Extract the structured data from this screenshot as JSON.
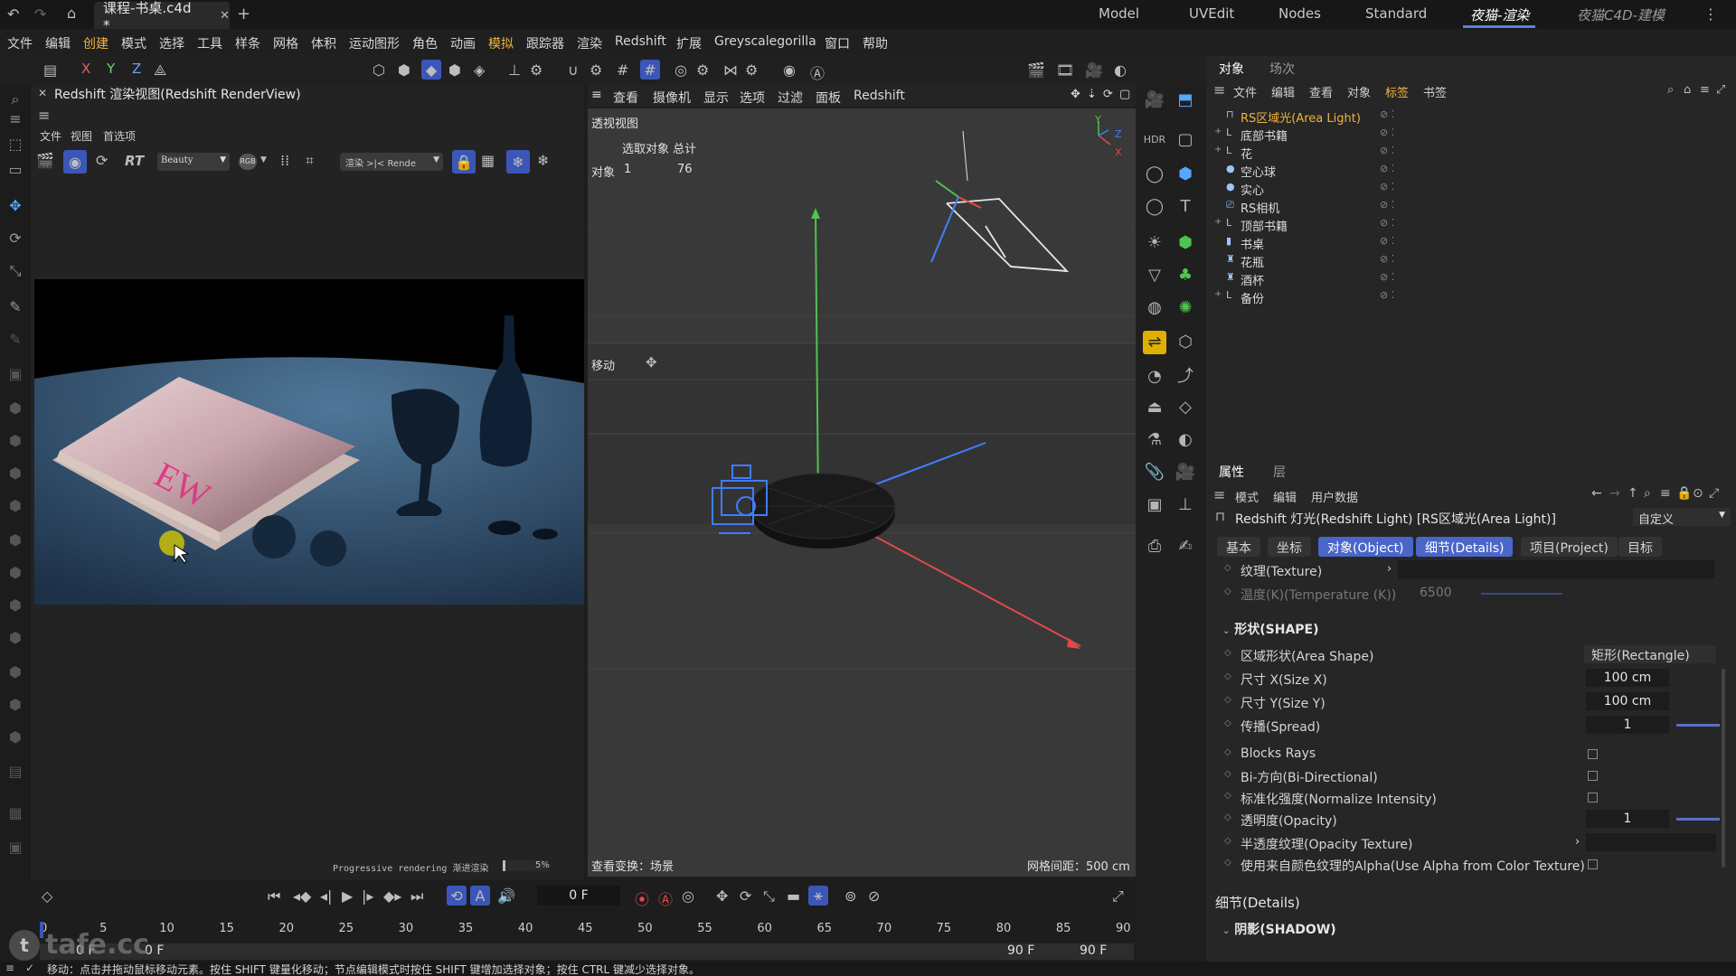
{
  "title_bar": {
    "doc_tab": "课程-书桌.c4d *",
    "layouts": [
      "Model",
      "UVEdit",
      "Nodes",
      "Standard",
      "夜猫-渲染",
      "夜猫C4D-建模"
    ],
    "active_layout": "夜猫-渲染"
  },
  "menu": [
    "文件",
    "编辑",
    "创建",
    "模式",
    "选择",
    "工具",
    "样条",
    "网格",
    "体积",
    "运动图形",
    "角色",
    "动画",
    "模拟",
    "跟踪器",
    "渲染",
    "Redshift",
    "扩展",
    "Greyscalegorilla",
    "窗口",
    "帮助"
  ],
  "axis_buttons": [
    "X",
    "Y",
    "Z"
  ],
  "render_view": {
    "title": "Redshift 渲染视图(Redshift RenderView)",
    "menu": [
      "文件",
      "视图",
      "首选项"
    ],
    "aov_select": "Beauty",
    "rgb_label": "RGB",
    "rt_label": "RT",
    "render_select": "渲染 >|< Rende",
    "status_text": "Progressive rendering 渐进渲染",
    "progress_percent": "5%",
    "progress_value": 0.05
  },
  "viewport": {
    "menu": [
      "查看",
      "摄像机",
      "显示",
      "选项",
      "过滤",
      "面板",
      "Redshift"
    ],
    "name": "透视视图",
    "stats_header": "选取对象 总计",
    "stats_label": "对象",
    "stats_selected": "1",
    "stats_total": "76",
    "tool_label": "移动",
    "footer_left": "查看变换：场景",
    "footer_right": "网格间距：500 cm"
  },
  "object_manager": {
    "tabs": [
      "对象",
      "场次"
    ],
    "menu": [
      "文件",
      "编辑",
      "查看",
      "对象",
      "标签",
      "书签"
    ],
    "objects": [
      {
        "name": "RS区域光(Area Light)",
        "icon": "light-icon",
        "selected": true,
        "expand": ""
      },
      {
        "name": "底部书籍",
        "icon": "null-icon",
        "selected": false,
        "expand": "+"
      },
      {
        "name": "花",
        "icon": "null-icon",
        "selected": false,
        "expand": "+"
      },
      {
        "name": "空心球",
        "icon": "sphere-icon",
        "selected": false,
        "expand": ""
      },
      {
        "name": "实心",
        "icon": "sphere-icon",
        "selected": false,
        "expand": ""
      },
      {
        "name": "RS相机",
        "icon": "camera-icon",
        "selected": false,
        "expand": ""
      },
      {
        "name": "顶部书籍",
        "icon": "null-icon",
        "selected": false,
        "expand": "+"
      },
      {
        "name": "书桌",
        "icon": "cylinder-icon",
        "selected": false,
        "expand": ""
      },
      {
        "name": "花瓶",
        "icon": "lathe-icon",
        "selected": false,
        "expand": ""
      },
      {
        "name": "酒杯",
        "icon": "lathe-icon",
        "selected": false,
        "expand": ""
      },
      {
        "name": "备份",
        "icon": "null-icon",
        "selected": false,
        "expand": "+"
      }
    ]
  },
  "attributes": {
    "tabs": [
      "属性",
      "层"
    ],
    "menu": [
      "模式",
      "编辑",
      "用户数据"
    ],
    "object_title": "Redshift 灯光(Redshift Light) [RS区域光(Area Light)]",
    "preset": "自定义",
    "subtabs": [
      "基本",
      "坐标",
      "对象(Object)",
      "细节(Details)",
      "项目(Project)",
      "目标"
    ],
    "active_subtabs": [
      "对象(Object)",
      "细节(Details)"
    ],
    "texture_label": "纹理(Texture)",
    "temperature_label": "温度(K)(Temperature (K))",
    "temperature_value": "6500",
    "shape_section": "形状(SHAPE)",
    "area_shape_label": "区域形状(Area Shape)",
    "area_shape_value": "矩形(Rectangle)",
    "size_x_label": "尺寸 X(Size X)",
    "size_x_value": "100 cm",
    "size_y_label": "尺寸 Y(Size Y)",
    "size_y_value": "100 cm",
    "spread_label": "传播(Spread)",
    "spread_value": "1",
    "blocks_rays_label": "Blocks Rays",
    "bidirectional_label": "Bi-方向(Bi-Directional)",
    "normalize_label": "标准化强度(Normalize Intensity)",
    "opacity_label": "透明度(Opacity)",
    "opacity_value": "1",
    "opacity_texture_label": "半透度纹理(Opacity Texture)",
    "alpha_label": "使用来自颜色纹理的Alpha(Use Alpha from Color Texture)",
    "details_section": "细节(Details)",
    "shadow_section": "阴影(SHADOW)"
  },
  "timeline": {
    "current_frame": "0 F",
    "ticks": [
      "0",
      "5",
      "10",
      "15",
      "20",
      "25",
      "30",
      "35",
      "40",
      "45",
      "50",
      "55",
      "60",
      "65",
      "70",
      "75",
      "80",
      "85",
      "90"
    ],
    "start_frame": "0 F",
    "start_frame2": "0 F",
    "end_frame": "90 F",
    "end_frame2": "90 F"
  },
  "status_bar": "移动：点击并拖动鼠标移动元素。按住 SHIFT 键量化移动；节点编辑模式时按住 SHIFT 键增加选择对象；按住 CTRL 键减少选择对象。",
  "watermark": "tafe.cc",
  "colors": {
    "accent": "#4a66c9",
    "selected_object": "#f0b43c",
    "axis_x": "#e04040",
    "axis_y": "#50c050",
    "axis_z": "#4080ff"
  }
}
